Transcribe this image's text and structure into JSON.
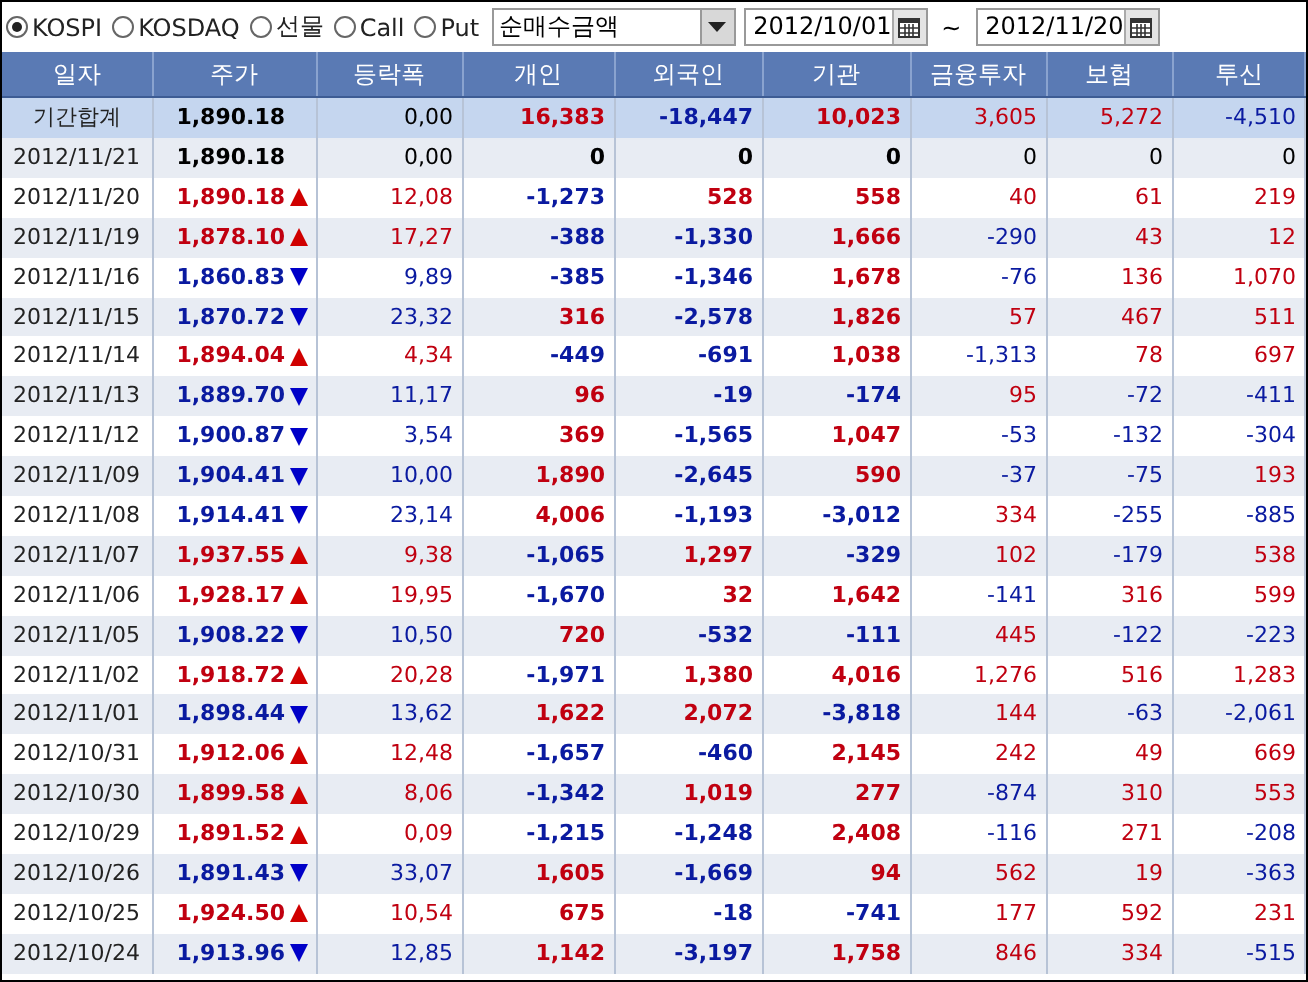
{
  "toolbar": {
    "markets": [
      {
        "label": "KOSPI",
        "selected": true
      },
      {
        "label": "KOSDAQ",
        "selected": false
      },
      {
        "label": "선물",
        "selected": false
      },
      {
        "label": "Call",
        "selected": false
      },
      {
        "label": "Put",
        "selected": false
      }
    ],
    "metric": "순매수금액",
    "date_from": "2012/10/01",
    "separator": "~",
    "date_to": "2012/11/20"
  },
  "table": {
    "columns": [
      "일자",
      "주가",
      "등락폭",
      "개인",
      "외국인",
      "기관",
      "금융투자",
      "보험",
      "투신"
    ],
    "rows": [
      {
        "kind": "total",
        "date": "기간합계",
        "price": "1,890.18",
        "rising": false,
        "falling": false,
        "change": "0,00",
        "values": [
          "16,383",
          "-18,447",
          "10,023",
          "3,605",
          "5,272",
          "-4,510"
        ]
      },
      {
        "kind": "day",
        "date": "2012/11/21",
        "price": "1,890.18",
        "rising": false,
        "falling": false,
        "change": "0,00",
        "values": [
          "0",
          "0",
          "0",
          "0",
          "0",
          "0"
        ]
      },
      {
        "kind": "day",
        "date": "2012/11/20",
        "price": "1,890.18",
        "rising": true,
        "falling": false,
        "change": "12,08",
        "values": [
          "-1,273",
          "528",
          "558",
          "40",
          "61",
          "219"
        ]
      },
      {
        "kind": "day",
        "date": "2012/11/19",
        "price": "1,878.10",
        "rising": true,
        "falling": false,
        "change": "17,27",
        "values": [
          "-388",
          "-1,330",
          "1,666",
          "-290",
          "43",
          "12"
        ]
      },
      {
        "kind": "day",
        "date": "2012/11/16",
        "price": "1,860.83",
        "rising": false,
        "falling": true,
        "change": "9,89",
        "values": [
          "-385",
          "-1,346",
          "1,678",
          "-76",
          "136",
          "1,070"
        ]
      },
      {
        "kind": "day",
        "date": "2012/11/15",
        "price": "1,870.72",
        "rising": false,
        "falling": true,
        "change": "23,32",
        "values": [
          "316",
          "-2,578",
          "1,826",
          "57",
          "467",
          "511"
        ]
      },
      {
        "kind": "day",
        "date": "2012/11/14",
        "price": "1,894.04",
        "rising": true,
        "falling": false,
        "change": "4,34",
        "values": [
          "-449",
          "-691",
          "1,038",
          "-1,313",
          "78",
          "697"
        ]
      },
      {
        "kind": "day",
        "date": "2012/11/13",
        "price": "1,889.70",
        "rising": false,
        "falling": true,
        "change": "11,17",
        "values": [
          "96",
          "-19",
          "-174",
          "95",
          "-72",
          "-411"
        ]
      },
      {
        "kind": "day",
        "date": "2012/11/12",
        "price": "1,900.87",
        "rising": false,
        "falling": true,
        "change": "3,54",
        "values": [
          "369",
          "-1,565",
          "1,047",
          "-53",
          "-132",
          "-304"
        ]
      },
      {
        "kind": "day",
        "date": "2012/11/09",
        "price": "1,904.41",
        "rising": false,
        "falling": true,
        "change": "10,00",
        "values": [
          "1,890",
          "-2,645",
          "590",
          "-37",
          "-75",
          "193"
        ]
      },
      {
        "kind": "day",
        "date": "2012/11/08",
        "price": "1,914.41",
        "rising": false,
        "falling": true,
        "change": "23,14",
        "values": [
          "4,006",
          "-1,193",
          "-3,012",
          "334",
          "-255",
          "-885"
        ]
      },
      {
        "kind": "day",
        "date": "2012/11/07",
        "price": "1,937.55",
        "rising": true,
        "falling": false,
        "change": "9,38",
        "values": [
          "-1,065",
          "1,297",
          "-329",
          "102",
          "-179",
          "538"
        ]
      },
      {
        "kind": "day",
        "date": "2012/11/06",
        "price": "1,928.17",
        "rising": true,
        "falling": false,
        "change": "19,95",
        "values": [
          "-1,670",
          "32",
          "1,642",
          "-141",
          "316",
          "599"
        ]
      },
      {
        "kind": "day",
        "date": "2012/11/05",
        "price": "1,908.22",
        "rising": false,
        "falling": true,
        "change": "10,50",
        "values": [
          "720",
          "-532",
          "-111",
          "445",
          "-122",
          "-223"
        ]
      },
      {
        "kind": "day",
        "date": "2012/11/02",
        "price": "1,918.72",
        "rising": true,
        "falling": false,
        "change": "20,28",
        "values": [
          "-1,971",
          "1,380",
          "4,016",
          "1,276",
          "516",
          "1,283"
        ]
      },
      {
        "kind": "day",
        "date": "2012/11/01",
        "price": "1,898.44",
        "rising": false,
        "falling": true,
        "change": "13,62",
        "values": [
          "1,622",
          "2,072",
          "-3,818",
          "144",
          "-63",
          "-2,061"
        ]
      },
      {
        "kind": "day",
        "date": "2012/10/31",
        "price": "1,912.06",
        "rising": true,
        "falling": false,
        "change": "12,48",
        "values": [
          "-1,657",
          "-460",
          "2,145",
          "242",
          "49",
          "669"
        ]
      },
      {
        "kind": "day",
        "date": "2012/10/30",
        "price": "1,899.58",
        "rising": true,
        "falling": false,
        "change": "8,06",
        "values": [
          "-1,342",
          "1,019",
          "277",
          "-874",
          "310",
          "553"
        ]
      },
      {
        "kind": "day",
        "date": "2012/10/29",
        "price": "1,891.52",
        "rising": true,
        "falling": false,
        "change": "0,09",
        "values": [
          "-1,215",
          "-1,248",
          "2,408",
          "-116",
          "271",
          "-208"
        ]
      },
      {
        "kind": "day",
        "date": "2012/10/26",
        "price": "1,891.43",
        "rising": false,
        "falling": true,
        "change": "33,07",
        "values": [
          "1,605",
          "-1,669",
          "94",
          "562",
          "19",
          "-363"
        ]
      },
      {
        "kind": "day",
        "date": "2012/10/25",
        "price": "1,924.50",
        "rising": true,
        "falling": false,
        "change": "10,54",
        "values": [
          "675",
          "-18",
          "-741",
          "177",
          "592",
          "231"
        ]
      },
      {
        "kind": "day",
        "date": "2012/10/24",
        "price": "1,913.96",
        "rising": false,
        "falling": true,
        "change": "12,85",
        "values": [
          "1,142",
          "-3,197",
          "1,758",
          "846",
          "334",
          "-515"
        ]
      }
    ]
  }
}
